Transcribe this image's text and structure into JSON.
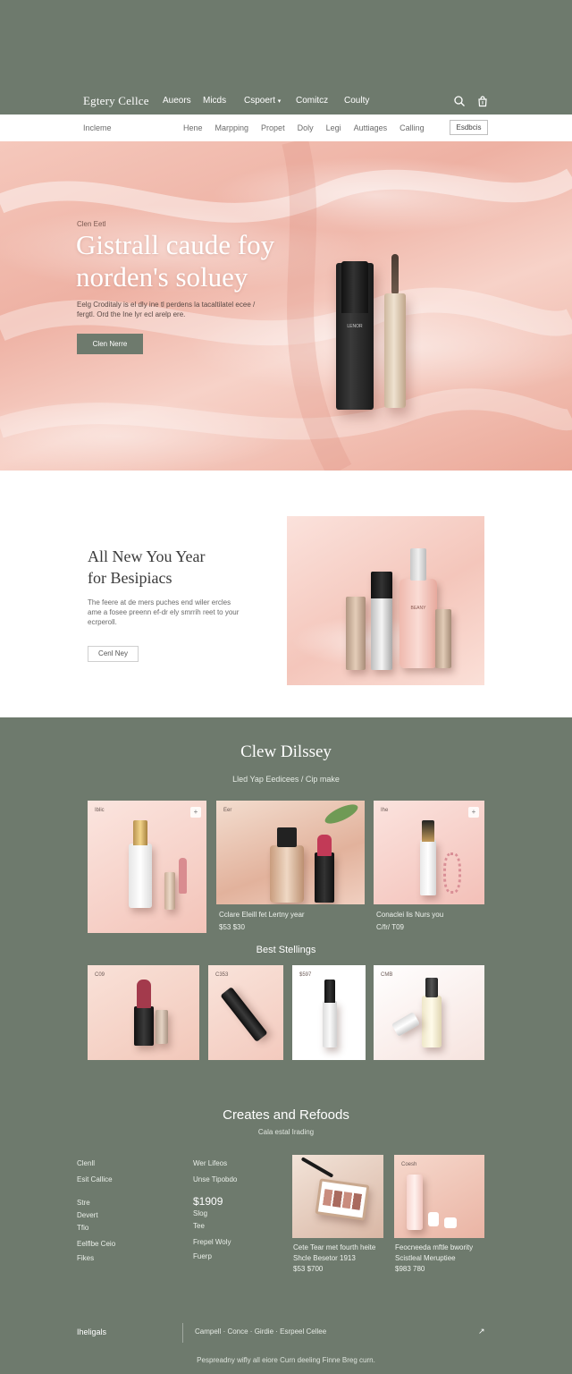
{
  "header": {
    "brand": "Egtery Cellce",
    "nav": [
      "Aueors",
      "Micds",
      "Cspoert",
      "Comitcz",
      "Coulty"
    ],
    "dropdown_indicator": "▾"
  },
  "subnav": {
    "home": "Incleme",
    "links": [
      "Hene",
      "Marpping",
      "Propet",
      "Doly",
      "Legi",
      "Auttiages",
      "Calling"
    ],
    "button": "Esdbcis"
  },
  "hero": {
    "eyebrow": "Clen Eetl",
    "title_line1": "Gistrall caude foy",
    "title_line2": "norden's soluey",
    "desc": "Eelg Croditaly is el dly ine tl perdens la tacaltilatel ecee / fergtl. Ord the Ine lyr ecl arelp ere.",
    "cta": "Clen Nerre",
    "product_label": "LENOR"
  },
  "feature": {
    "title_line1": "All New You Year",
    "title_line2": "for Besipiacs",
    "desc": "The feere at de mers puches end wiler ercles ame a fosee preenn ef-dr ely smrrih reet to your ecrperoll.",
    "cta": "Cenl Ney",
    "arrow": "›",
    "product_label": "BEANY"
  },
  "clew": {
    "title": "Clew Dilssey",
    "subtitle": "Lled Yap Eedicees / Cip make",
    "cards": [
      {
        "tag": "Iblic",
        "plus": "+",
        "caption": "",
        "price": ""
      },
      {
        "tag": "Eer",
        "plus": "",
        "caption": "Cclare Eleill fet Lertny year",
        "price": "$53 $30"
      },
      {
        "tag": "Ihe",
        "plus": "+",
        "caption": "Conaclei lis Nurs you",
        "price": "C/fr/ T09"
      }
    ]
  },
  "best": {
    "title": "Best Stellings",
    "cards": [
      {
        "tag": "C09"
      },
      {
        "tag": "C353"
      },
      {
        "tag": "$597"
      },
      {
        "tag": "CMB"
      }
    ]
  },
  "creates": {
    "title": "Creates and Refoods",
    "subtitle": "Cala estal Irading",
    "col1": [
      "Clenll",
      "Esit Callice",
      "Stre",
      "Devert",
      "Tfio",
      "Eelflbe Ceio",
      "Fikes"
    ],
    "col2": [
      "Wer Lifeos",
      "Unse Tipobdo",
      "$1909",
      "Slog",
      "Tee",
      "Frepel Woly",
      "Fuerp"
    ],
    "promos": [
      {
        "caption_line1": "Cete Tear met fourth heite",
        "caption_line2": "Shcle Besetor 1913",
        "price": "$53 $700",
        "tag": ""
      },
      {
        "caption_line1": "Feocneeda mftle bwority",
        "caption_line2": "Scistleal Meruptiee",
        "price": "$983 780",
        "tag": "Coesh"
      }
    ]
  },
  "footer": {
    "brand": "Iheligals",
    "links": "Campell  ·  Conce  ·  Girdie  ·  Esrpeel Cellee",
    "icon": "↗",
    "copyright": "Pespreadny wifly all eiore Curn deeling Finne Breg curn."
  },
  "colors": {
    "sage": "#6e7a6d",
    "blush": "#f5c8bc",
    "white": "#ffffff"
  }
}
